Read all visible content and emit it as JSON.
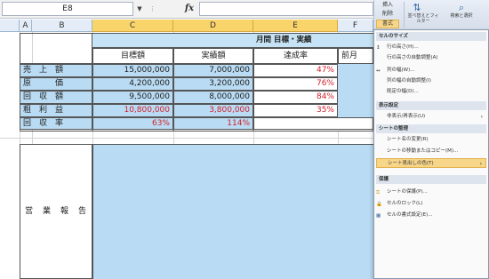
{
  "formula_bar": {
    "name_box": "E8",
    "name_box_dropdown": "▼",
    "grip": "⋮",
    "fx_label": "fx",
    "formula": ""
  },
  "columns": {
    "A": "A",
    "B": "B",
    "C": "C",
    "D": "D",
    "E": "E",
    "F": "F"
  },
  "sheet": {
    "title": "月間 目標・実績",
    "headers": {
      "target": "目標額",
      "actual": "実績額",
      "rate": "達成率",
      "prev": "前月"
    },
    "rows": [
      {
        "label": "売　上　額",
        "target": "15,000,000",
        "actual": "7,000,000",
        "rate": "47%"
      },
      {
        "label": "原　　　価",
        "target": "4,200,000",
        "actual": "3,200,000",
        "rate": "76%"
      },
      {
        "label": "回　収　額",
        "target": "9,500,000",
        "actual": "8,000,000",
        "rate": "84%"
      },
      {
        "label": "粗　利　益",
        "target": "10,800,000",
        "actual": "3,800,000",
        "rate": "35%"
      },
      {
        "label": "回　収　率",
        "target": "63%",
        "actual": "114%",
        "rate": ""
      }
    ],
    "report_label": "営　業　報　告"
  },
  "ribbon": {
    "insert": "挿入",
    "delete": "削除",
    "format": "書式",
    "sort": "並べ替えとフィルター",
    "find": "検索と選択"
  },
  "menu": {
    "section_size": "セルのサイズ",
    "row_height": "行の高さ(H)...",
    "autofit_row": "行の高さの自動調整(A)",
    "col_width": "列の幅(W)...",
    "autofit_col": "列の幅の自動調整(I)",
    "default_width": "既定の幅(D)...",
    "section_visibility": "表示設定",
    "hide_unhide": "非表示/再表示(U)",
    "section_sheet": "シートの整理",
    "rename_sheet": "シート名の変更(R)",
    "move_copy": "シートの移動またはコピー(M)...",
    "tab_color": "シート見出しの色(T)",
    "section_protect": "保護",
    "protect_sheet": "シートの保護(P)...",
    "lock_cell": "セルのロック(L)",
    "format_cells": "セルの書式設定(E)..."
  },
  "colors": {
    "header_blue": "#c5e3f5",
    "cell_blue": "#b9dbf3",
    "red_text": "#d3232e",
    "highlight": "#f7d68a"
  }
}
